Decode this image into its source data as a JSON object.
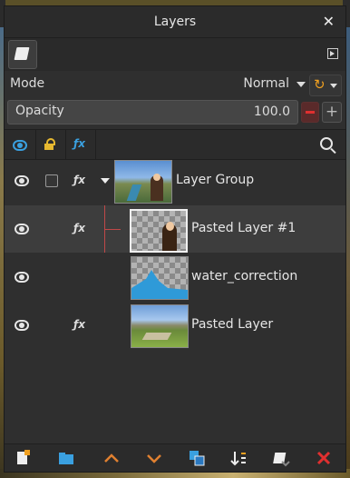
{
  "window": {
    "title": "Layers",
    "close_icon": "close-icon"
  },
  "tabs": [
    {
      "icon": "layers-tab-icon"
    }
  ],
  "mode": {
    "label": "Mode",
    "value": "Normal"
  },
  "opacity": {
    "label": "Opacity",
    "value": "100.0"
  },
  "layers": [
    {
      "name": "Layer Group",
      "visible": true,
      "fx": true,
      "expanded": true
    },
    {
      "name": "Pasted Layer #1",
      "visible": true,
      "fx": true,
      "selected": true
    },
    {
      "name": "water_correction",
      "visible": true,
      "fx": false
    },
    {
      "name": "Pasted Layer",
      "visible": true,
      "fx": true
    }
  ],
  "colors": {
    "panel_bg": "#2f2f2f",
    "accent_blue": "#3aa0e0",
    "accent_orange": "#f0a020",
    "delete_red": "#e03030"
  },
  "toolbar_icons": [
    "new-layer-icon",
    "new-group-icon",
    "raise-layer-icon",
    "lower-layer-icon",
    "duplicate-layer-icon",
    "merge-down-icon",
    "anchor-icon",
    "delete-layer-icon"
  ]
}
